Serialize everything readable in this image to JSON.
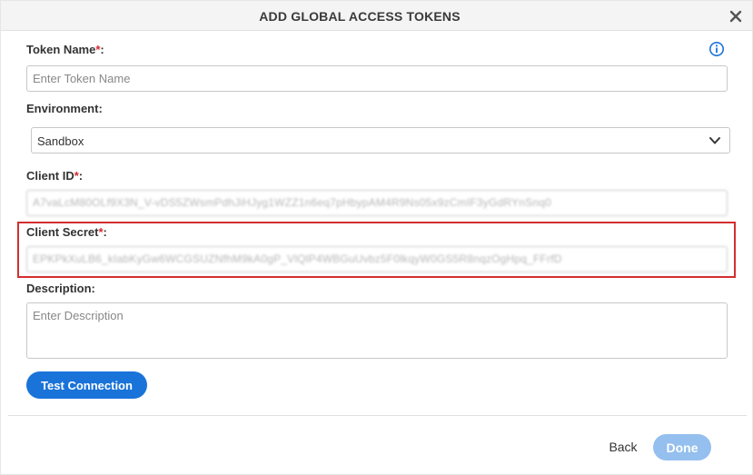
{
  "dialog": {
    "title": "ADD GLOBAL ACCESS TOKENS"
  },
  "form": {
    "token_name": {
      "label": "Token Name",
      "required": "*",
      "suffix": ":",
      "placeholder": "Enter Token Name"
    },
    "environment": {
      "label": "Environment:",
      "selected": "Sandbox"
    },
    "client_id": {
      "label": "Client ID",
      "required": "*",
      "suffix": ":",
      "value": "A7vaLcM80OLf9X3N_V-vDS5ZWsmPdhJiHJyg1WZZ1n6eq7pHbypAM4R9Ns05x9zCmIF3yGdRYnSnq0"
    },
    "client_secret": {
      "label": "Client Secret",
      "required": "*",
      "suffix": ":",
      "value": "EPKPkXuLB6_kIabKyGw6WCGSUZNfhM9kA0gP_VlQlP4WBGuUvbz5F0lkqyW0GS5R8nqzOgHpq_FFrfD"
    },
    "description": {
      "label": "Description:",
      "placeholder": "Enter Description"
    }
  },
  "buttons": {
    "test_connection": "Test Connection",
    "back": "Back",
    "done": "Done"
  },
  "colors": {
    "primary": "#1a73d9",
    "done_disabled": "#94bfee",
    "required": "#d9262c",
    "highlight": "#d32f2f"
  },
  "icons": {
    "close": "close-icon",
    "info": "info-icon",
    "dropdown": "chevron-down-icon"
  }
}
